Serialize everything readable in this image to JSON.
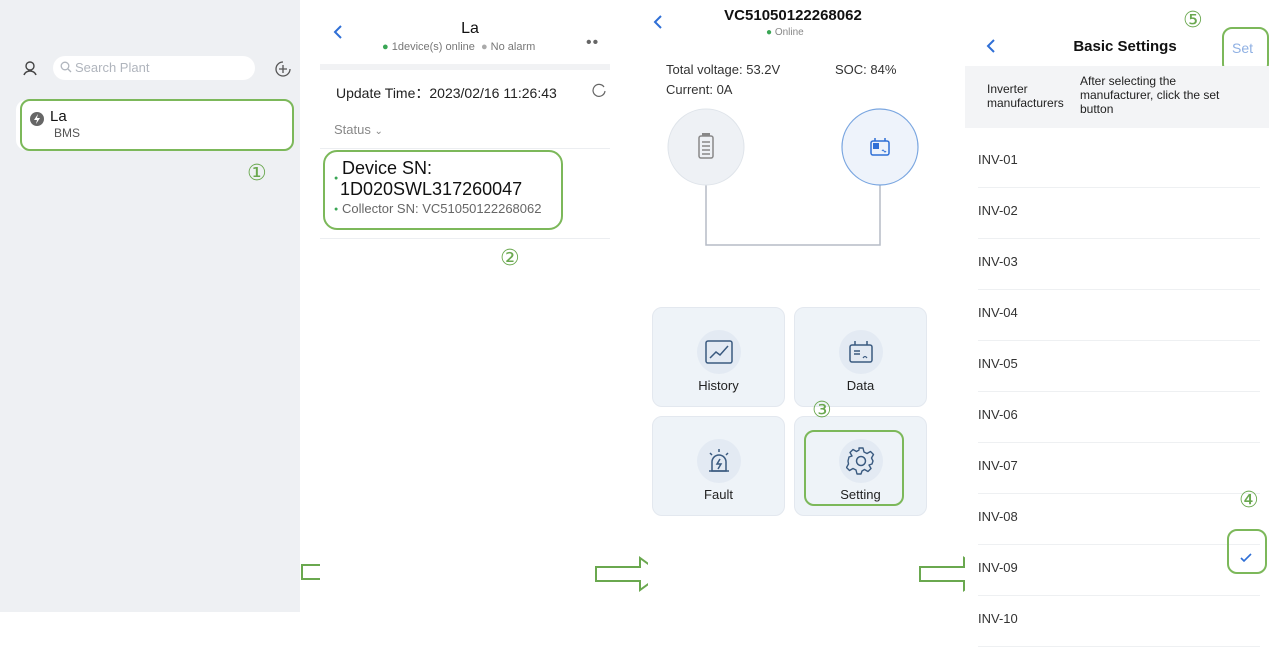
{
  "panel1": {
    "search_placeholder": "Search Plant",
    "plant": {
      "name": "La",
      "type": "BMS"
    },
    "step_marker": "①"
  },
  "panel2": {
    "title": "La",
    "status_online": "1device(s) online",
    "status_alarm": "No alarm",
    "update_label": "Update Time：",
    "update_value": "2023/02/16 11:26:43",
    "status_filter": "Status",
    "device_sn_label": "Device SN:",
    "device_sn_value": "1D020SWL317260047",
    "collector_sn": "Collector SN: VC51050122268062",
    "step_marker": "②"
  },
  "panel3": {
    "title": "VC51050122268062",
    "status": "Online",
    "total_voltage": "Total voltage: 53.2V",
    "soc": "SOC: 84%",
    "current": "Current: 0A",
    "tiles": {
      "history": "History",
      "data": "Data",
      "fault": "Fault",
      "setting": "Setting"
    },
    "step_marker": "③"
  },
  "panel4": {
    "title": "Basic Settings",
    "set_button": "Set",
    "header_label": "Inverter manufacturers",
    "header_hint": "After selecting the manufacturer, click the set button",
    "items": [
      "INV-01",
      "INV-02",
      "INV-03",
      "INV-04",
      "INV-05",
      "INV-06",
      "INV-07",
      "INV-08",
      "INV-09",
      "INV-10"
    ],
    "selected_item": "INV-09",
    "step_marker_4": "④",
    "step_marker_5": "⑤"
  },
  "colors": {
    "highlight": "#7cb85a",
    "accent": "#2f6fd6",
    "online": "#3aa655"
  }
}
